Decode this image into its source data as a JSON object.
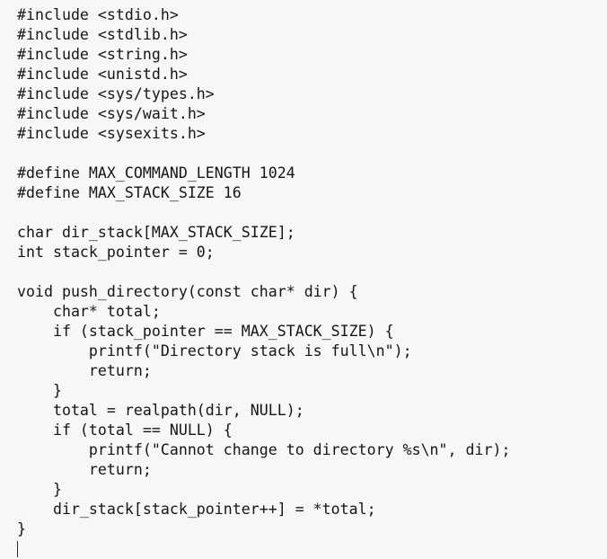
{
  "editor": {
    "name": "code-editor",
    "language": "c",
    "background_color": "#f7f7f7",
    "text_color": "#161616",
    "caret_color": "#2b2b2b",
    "caret_line_index": 25,
    "caret_column": 0
  },
  "code": {
    "lines": [
      "#include <stdio.h>",
      "#include <stdlib.h>",
      "#include <string.h>",
      "#include <unistd.h>",
      "#include <sys/types.h>",
      "#include <sys/wait.h>",
      "#include <sysexits.h>",
      "",
      "#define MAX_COMMAND_LENGTH 1024",
      "#define MAX_STACK_SIZE 16",
      "",
      "char dir_stack[MAX_STACK_SIZE];",
      "int stack_pointer = 0;",
      "",
      "void push_directory(const char* dir) {",
      "    char* total;",
      "    if (stack_pointer == MAX_STACK_SIZE) {",
      "        printf(\"Directory stack is full\\n\");",
      "        return;",
      "    }",
      "    total = realpath(dir, NULL);",
      "    if (total == NULL) {",
      "        printf(\"Cannot change to directory %s\\n\", dir);",
      "        return;",
      "    }",
      "    dir_stack[stack_pointer++] = *total;",
      "}"
    ]
  }
}
